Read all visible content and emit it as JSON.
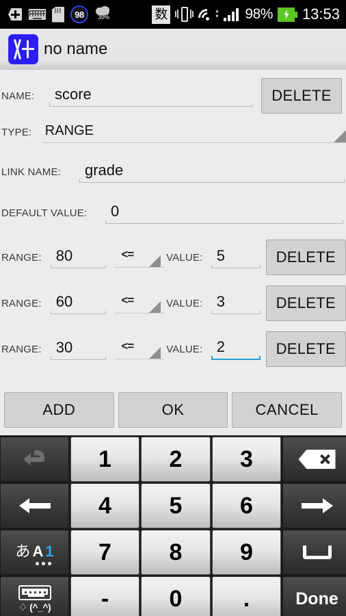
{
  "statusbar": {
    "left_icons": [
      "plus-tag-icon",
      "keyboard-icon",
      "sd-card-icon",
      "battery-percent-98-icon",
      "cloud-30-percent-icon"
    ],
    "ime_badge": "数",
    "right_icons": [
      "vibrate-icon",
      "wifi-icon",
      "signal-bars-icon"
    ],
    "battery_percent": "98%",
    "time": "13:53"
  },
  "header": {
    "app_icon": "x-plus-logo",
    "title": "no name"
  },
  "form": {
    "name": {
      "label": "NAME:",
      "value": "score",
      "delete_label": "DELETE"
    },
    "type": {
      "label": "TYPE:",
      "value": "RANGE"
    },
    "link_name": {
      "label": "LINK NAME:",
      "value": "grade"
    },
    "default_value": {
      "label": "DEFAULT VALUE:",
      "value": "0"
    },
    "range_label": "RANGE:",
    "value_label": "VALUE:",
    "delete_label": "DELETE",
    "rows": [
      {
        "range": "80",
        "operator": "<=",
        "value": "5",
        "focused": false
      },
      {
        "range": "60",
        "operator": "<=",
        "value": "3",
        "focused": false
      },
      {
        "range": "30",
        "operator": "<=",
        "value": "2",
        "focused": true
      }
    ]
  },
  "actions": {
    "add": "ADD",
    "ok": "OK",
    "cancel": "CANCEL"
  },
  "keyboard": {
    "rows": [
      [
        {
          "type": "fn",
          "icon": "undo-icon",
          "label": "",
          "dim": true
        },
        {
          "type": "num",
          "label": "1"
        },
        {
          "type": "num",
          "label": "2"
        },
        {
          "type": "num",
          "label": "3"
        },
        {
          "type": "fn",
          "icon": "backspace-icon",
          "label": ""
        }
      ],
      [
        {
          "type": "fn",
          "icon": "arrow-left-icon",
          "label": ""
        },
        {
          "type": "num",
          "label": "4"
        },
        {
          "type": "num",
          "label": "5"
        },
        {
          "type": "num",
          "label": "6"
        },
        {
          "type": "fn",
          "icon": "arrow-right-icon",
          "label": ""
        }
      ],
      [
        {
          "type": "fn",
          "icon": "ime-switch-icon",
          "label": "あA1"
        },
        {
          "type": "num",
          "label": "7"
        },
        {
          "type": "num",
          "label": "8"
        },
        {
          "type": "num",
          "label": "9"
        },
        {
          "type": "fn",
          "icon": "space-icon",
          "label": ""
        }
      ],
      [
        {
          "type": "fn",
          "icon": "keyboard-settings-icon",
          "label": "(^_^)"
        },
        {
          "type": "num",
          "label": "-"
        },
        {
          "type": "num",
          "label": "0"
        },
        {
          "type": "num",
          "label": "."
        },
        {
          "type": "fn",
          "icon": "",
          "label": "Done"
        }
      ]
    ],
    "ime_chars": {
      "kana": "あ",
      "alpha": "A",
      "digit": "1"
    },
    "done_label": "Done",
    "emoticon": "(^_^)"
  },
  "colors": {
    "accent_focus": "#2b9ed6",
    "logo_blue": "#2b1ef0",
    "battery_green": "#5bc721",
    "page_bg": "#ececec",
    "button_gray": "#d2d2d2"
  }
}
